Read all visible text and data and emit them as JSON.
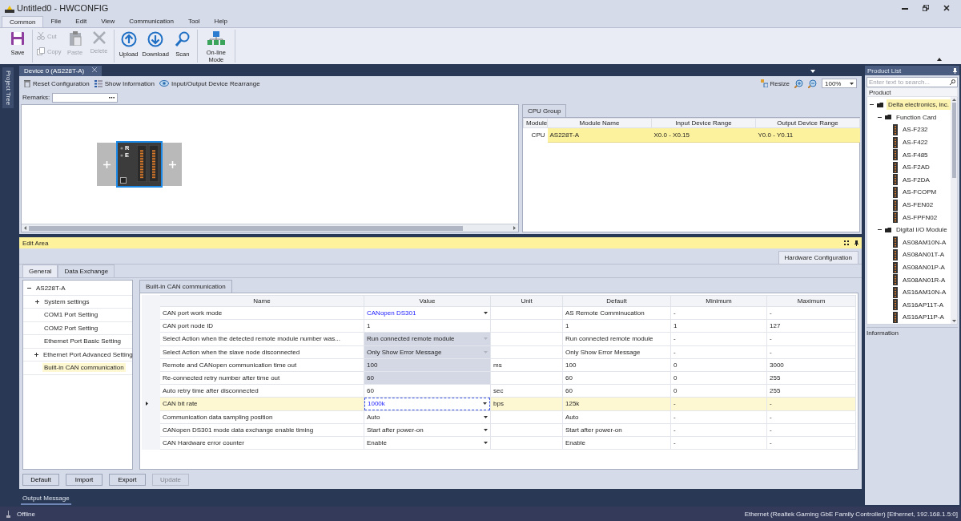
{
  "window": {
    "title": "Untitled0 - HWCONFIG"
  },
  "menu_tabs": [
    {
      "label": "Common",
      "selected": true
    },
    {
      "label": "File",
      "selected": false
    },
    {
      "label": "Edit",
      "selected": false
    },
    {
      "label": "View",
      "selected": false
    },
    {
      "label": "Communication",
      "selected": false
    },
    {
      "label": "Tool",
      "selected": false
    },
    {
      "label": "Help",
      "selected": false
    }
  ],
  "ribbon": {
    "groups": [
      [
        {
          "label": "Save",
          "kind": "large",
          "disabled": false
        }
      ],
      [
        {
          "label": "Cut",
          "kind": "small",
          "disabled": true
        },
        {
          "label": "Copy",
          "kind": "small",
          "disabled": true
        },
        {
          "label": "Paste",
          "kind": "large",
          "disabled": true
        },
        {
          "label": "Delete",
          "kind": "large",
          "disabled": true
        }
      ],
      [
        {
          "label": "Upload",
          "kind": "large",
          "disabled": false
        },
        {
          "label": "Download",
          "kind": "large",
          "disabled": false
        },
        {
          "label": "Scan",
          "kind": "large",
          "disabled": false
        }
      ],
      [
        {
          "label": "On-line Mode",
          "kind": "large",
          "disabled": false
        }
      ]
    ]
  },
  "side_tab": {
    "label": "Project Tree"
  },
  "document_tab": {
    "label": "Device 0 (AS228T-A)"
  },
  "device_toolbar": {
    "actions": [
      {
        "label": "Reset Configuration"
      },
      {
        "label": "Show Information"
      },
      {
        "label": "Input/Output Device Rearrange"
      }
    ],
    "resize": "Resize",
    "zoom": "100%"
  },
  "remarks": {
    "label": "Remarks:"
  },
  "rack": {
    "cpu_leds": [
      {
        "label": "R"
      },
      {
        "label": "E"
      }
    ]
  },
  "cpu_group": {
    "tab": "CPU Group",
    "columns": [
      "Module",
      "Module Name",
      "Input Device Range",
      "Output Device Range"
    ],
    "rows": [
      {
        "cells": [
          "CPU",
          "AS228T-A",
          "X0.0 - X0.15",
          "Y0.0 - Y0.11"
        ],
        "selected": true
      }
    ]
  },
  "edit_area": {
    "title": "Edit Area",
    "right_tab": "Hardware Configuration",
    "tabs": [
      {
        "label": "General",
        "selected": true
      },
      {
        "label": "Data Exchange",
        "selected": false
      }
    ],
    "tree": [
      {
        "label": "AS228T-A",
        "expanded": true,
        "selected": false,
        "children": [
          {
            "label": "System settings",
            "expanded": false,
            "selected": false
          },
          {
            "label": "COM1 Port Setting",
            "selected": false
          },
          {
            "label": "COM2 Port Setting",
            "selected": false
          },
          {
            "label": "Ethernet Port Basic Setting",
            "selected": false
          },
          {
            "label": "Ethernet Port Advanced Setting",
            "expanded": false,
            "selected": false
          },
          {
            "label": "Built-in CAN communication",
            "selected": true
          }
        ]
      }
    ],
    "param_tab": "Built-in CAN communication",
    "columns": [
      "Name",
      "Value",
      "Unit",
      "Default",
      "Minimum",
      "Maximum"
    ],
    "rows": [
      {
        "name": "CAN port work mode",
        "value": "CANopen DS301",
        "kind": "dropdown",
        "readonly": false,
        "changed": true,
        "selected": false,
        "default": "AS Remote Comminucation",
        "min": "-",
        "max": "-"
      },
      {
        "name": "CAN port node ID",
        "value": "1",
        "kind": "text",
        "readonly": false,
        "changed": false,
        "selected": false,
        "default": "1",
        "min": "1",
        "max": "127"
      },
      {
        "name": "Select Action when the detected remote module number was...",
        "value": "Run connected remote module",
        "kind": "dropdown",
        "readonly": true,
        "changed": false,
        "selected": false,
        "default": "Run connected remote module",
        "min": "-",
        "max": "-"
      },
      {
        "name": "Select Action when the slave node disconnected",
        "value": "Only Show Error Message",
        "kind": "dropdown",
        "readonly": true,
        "changed": false,
        "selected": false,
        "default": "Only Show Error Message",
        "min": "-",
        "max": "-"
      },
      {
        "name": "Remote and CANopen communication time out",
        "value": "100",
        "kind": "text",
        "readonly": true,
        "changed": false,
        "selected": false,
        "unit": "ms",
        "default": "100",
        "min": "0",
        "max": "3000"
      },
      {
        "name": "Re-connected retry number after time out",
        "value": "60",
        "kind": "text",
        "readonly": true,
        "changed": false,
        "selected": false,
        "default": "60",
        "min": "0",
        "max": "255"
      },
      {
        "name": "Auto retry time after disconnected",
        "value": "60",
        "kind": "text",
        "readonly": false,
        "changed": false,
        "selected": false,
        "unit": "sec",
        "default": "60",
        "min": "0",
        "max": "255"
      },
      {
        "name": "CAN bit rate",
        "value": "1000k",
        "kind": "dropdown",
        "readonly": false,
        "changed": true,
        "selected": true,
        "unit": "bps",
        "default": "125k",
        "min": "-",
        "max": "-"
      },
      {
        "name": "Communication data sampling position",
        "value": "Auto",
        "kind": "dropdown",
        "readonly": false,
        "changed": false,
        "selected": false,
        "default": "Auto",
        "min": "-",
        "max": "-"
      },
      {
        "name": "CANopen DS301 mode data exchange enable timing",
        "value": "Start after power-on",
        "kind": "dropdown",
        "readonly": false,
        "changed": false,
        "selected": false,
        "default": "Start after power-on",
        "min": "-",
        "max": "-"
      },
      {
        "name": "CAN Hardware error counter",
        "value": "Enable",
        "kind": "dropdown",
        "readonly": false,
        "changed": false,
        "selected": false,
        "default": "Enable",
        "min": "-",
        "max": "-"
      }
    ],
    "buttons": [
      {
        "label": "Default",
        "disabled": false
      },
      {
        "label": "Import",
        "disabled": false
      },
      {
        "label": "Export",
        "disabled": false
      },
      {
        "label": "Update",
        "disabled": true
      }
    ]
  },
  "output_tab": {
    "label": "Output Message"
  },
  "product_list": {
    "title": "Product List",
    "search_placeholder": "Enter text to search...",
    "column": "Product",
    "tree": [
      {
        "label": "Delta electronics, inc.",
        "expanded": true,
        "selected": true,
        "children": [
          {
            "label": "Function Card",
            "expanded": true,
            "selected": false,
            "children": [
              {
                "label": "AS-F232",
                "selected": false
              },
              {
                "label": "AS-F422",
                "selected": false
              },
              {
                "label": "AS-F485",
                "selected": false
              },
              {
                "label": "AS-F2AD",
                "selected": false
              },
              {
                "label": "AS-F2DA",
                "selected": false
              },
              {
                "label": "AS-FCOPM",
                "selected": false
              },
              {
                "label": "AS-FEN02",
                "selected": false
              },
              {
                "label": "AS-FPFN02",
                "selected": false
              }
            ]
          },
          {
            "label": "Digital I/O Module",
            "expanded": true,
            "selected": false,
            "children": [
              {
                "label": "AS08AM10N-A",
                "selected": false
              },
              {
                "label": "AS08AN01T-A",
                "selected": false
              },
              {
                "label": "AS08AN01P-A",
                "selected": false
              },
              {
                "label": "AS08AN01R-A",
                "selected": false
              },
              {
                "label": "AS16AM10N-A",
                "selected": false
              },
              {
                "label": "AS16AP11T-A",
                "selected": false
              },
              {
                "label": "AS16AP11P-A",
                "selected": false
              }
            ]
          }
        ]
      }
    ],
    "info_title": "Information"
  },
  "status_bar": {
    "state": "Offline",
    "connection": "Ethernet (Realtek Gaming GbE Family Controller) [Ethernet, 192.168.1.5:0]"
  }
}
